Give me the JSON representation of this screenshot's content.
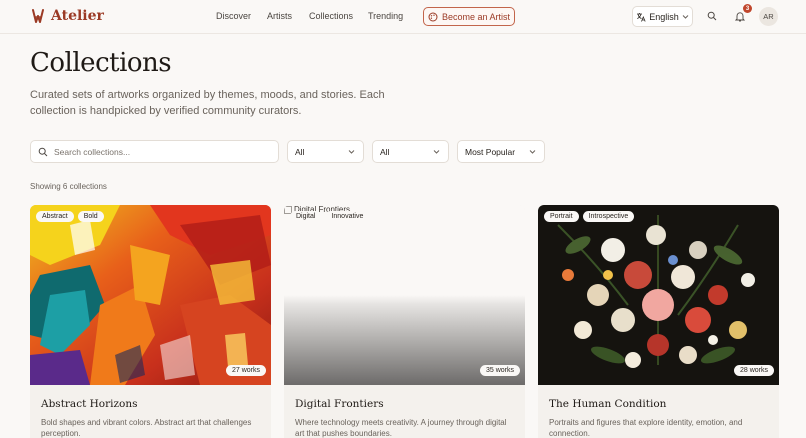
{
  "header": {
    "brand": "Atelier",
    "nav": [
      "Discover",
      "Artists",
      "Collections",
      "Trending"
    ],
    "become_artist": "Become an Artist",
    "language": "English",
    "notification_count": "3",
    "avatar_initials": "AR",
    "accent": "#9b3a25"
  },
  "page": {
    "title": "Collections",
    "description": "Curated sets of artworks organized by themes, moods, and stories. Each collection is handpicked by verified community curators."
  },
  "filters": {
    "search_placeholder": "Search collections...",
    "filter1": "All",
    "filter2": "All",
    "sort": "Most Popular"
  },
  "showing": "Showing 6 collections",
  "collections": [
    {
      "tags": [
        "Abstract",
        "Bold"
      ],
      "works": "27 works",
      "title": "Abstract Horizons",
      "description": "Bold shapes and vibrant colors. Abstract art that challenges perception."
    },
    {
      "tags": [
        "Digital",
        "Innovative"
      ],
      "works": "35 works",
      "title": "Digital Frontiers",
      "image_alt": "Digital Frontiers",
      "description": "Where technology meets creativity. A journey through digital art that pushes boundaries."
    },
    {
      "tags": [
        "Portrait",
        "Introspective"
      ],
      "works": "28 works",
      "title": "The Human Condition",
      "description": "Portraits and figures that explore identity, emotion, and connection."
    }
  ]
}
